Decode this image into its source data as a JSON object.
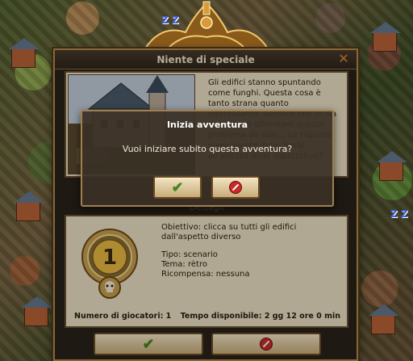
{
  "dialog": {
    "title": "Niente di speciale",
    "close_icon": "close-icon",
    "story_text": "Gli edifici stanno spuntando come funghi. Questa cosa è tanto strana quanto interessante. Sembra che tu sia in grado di affrontare questo problema da solo... Le risposte sono riposte in te. Sarai all'altezza delle aspettative?",
    "details_header": "Dettagli",
    "medal_number": "1",
    "objective": "Obiettivo: clicca su tutti gli edifici dall'aspetto diverso",
    "type": "Tipo: scenario",
    "theme": "Tema: rètro",
    "reward": "Ricompensa: nessuna",
    "players": "Numero di giocatori: 1",
    "time_available": "Tempo disponibile: 2 gg 12 ore 0 min",
    "accept_icon": "check-icon",
    "decline_icon": "no-entry-icon"
  },
  "confirm": {
    "title": "Inizia avventura",
    "question": "Vuoi iniziare subito questa avventura?",
    "yes_icon": "check-icon",
    "no_icon": "no-entry-icon"
  },
  "colors": {
    "accept_green": "#3a8a1a",
    "decline_red": "#c82a2a",
    "close_orange": "#e08a2a",
    "frame_gold": "#b08a4a"
  }
}
